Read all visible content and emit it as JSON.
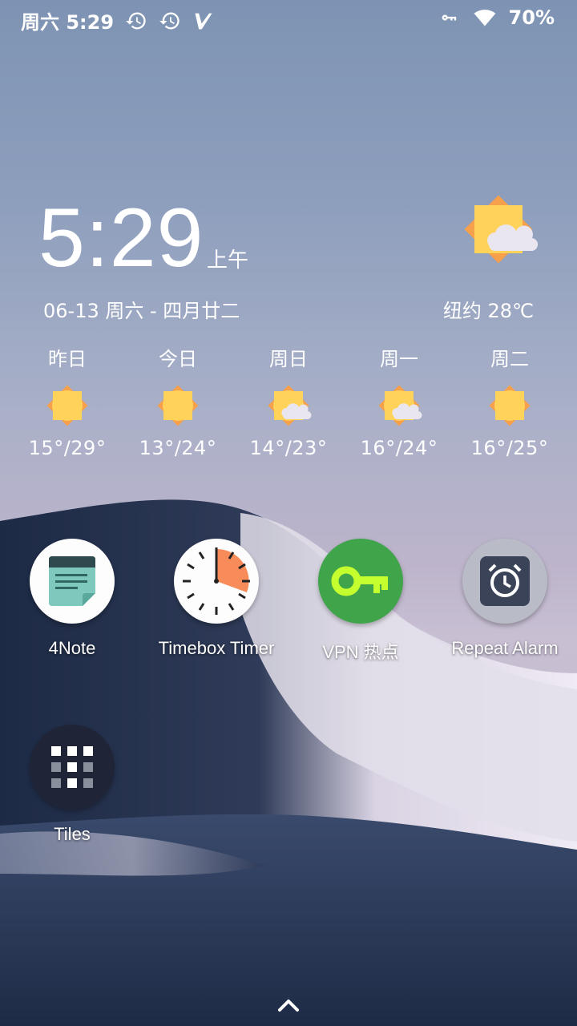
{
  "status_bar": {
    "time": "周六 5:29",
    "battery": "70%",
    "icons_left": [
      "history-icon",
      "history-icon",
      "v-logo-icon"
    ],
    "icons_right": [
      "vpn-key-icon",
      "wifi-icon"
    ]
  },
  "clock_widget": {
    "time": "5:29",
    "ampm": "上午",
    "date": "06-13 周六 - 四月廿二",
    "city_temp": "纽约 28℃",
    "current_icon": "sun-cloud-icon"
  },
  "forecast": [
    {
      "day": "昨日",
      "temp": "15°/29°",
      "icon": "sun-icon"
    },
    {
      "day": "今日",
      "temp": "13°/24°",
      "icon": "sun-icon"
    },
    {
      "day": "周日",
      "temp": "14°/23°",
      "icon": "sun-cloud-icon"
    },
    {
      "day": "周一",
      "temp": "16°/24°",
      "icon": "sun-cloud-icon"
    },
    {
      "day": "周二",
      "temp": "16°/25°",
      "icon": "sun-icon"
    }
  ],
  "apps": [
    {
      "label": "4Note",
      "icon": "note-icon"
    },
    {
      "label": "Timebox Timer",
      "icon": "timer-icon"
    },
    {
      "label": "VPN 热点",
      "icon": "key-icon"
    },
    {
      "label": "Repeat Alarm",
      "icon": "alarm-clock-icon"
    },
    {
      "label": "Tiles",
      "icon": "grid-icon"
    }
  ],
  "colors": {
    "sun": "#ffd35a",
    "sun_back": "#f6a04b",
    "timer_accent": "#f88b5a",
    "vpn_green": "#3fa44a",
    "vpn_key": "#c6ff2e",
    "note_teal": "#7fc8bd"
  }
}
